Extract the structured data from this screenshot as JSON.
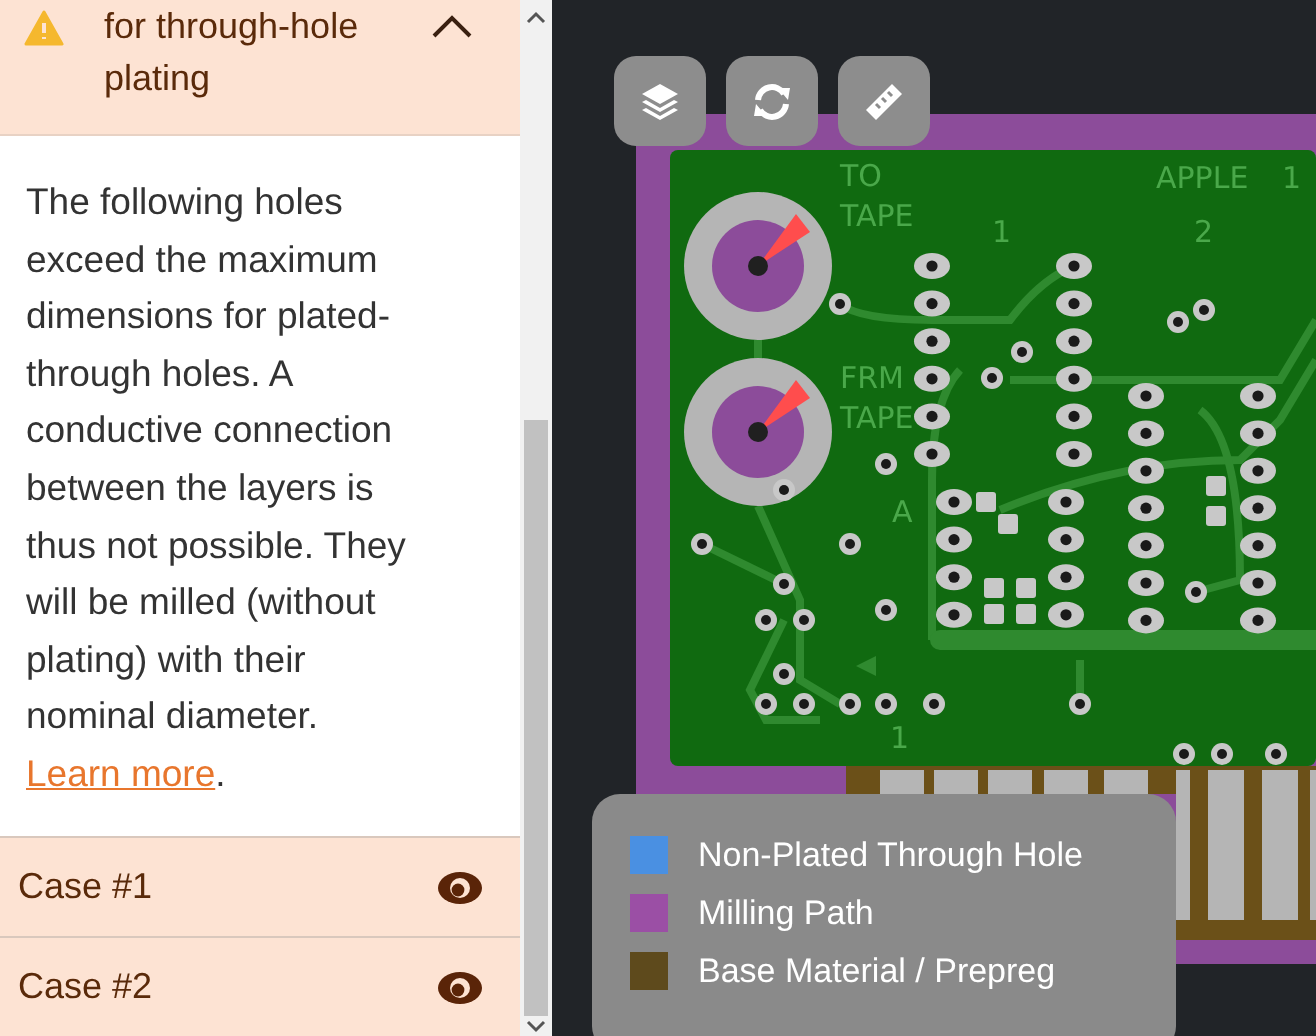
{
  "panel": {
    "header": {
      "title": "for through-hole plating",
      "expanded": true
    },
    "description": {
      "text": "The following holes exceed the maximum dimensions for plated-through holes. A conductive connection between the layers is thus not possible. They will be milled (without plating) with their nominal diameter.",
      "link": "Learn more",
      "after": "."
    },
    "cases": [
      {
        "label": "Case #1"
      },
      {
        "label": "Case #2"
      }
    ]
  },
  "board": {
    "silkscreen": [
      "TO",
      "TAPE",
      "APPLE",
      "1",
      "1",
      "2",
      "FRM",
      "TAPE",
      "A",
      "1"
    ]
  },
  "legend": [
    {
      "label": "Non-Plated Through Hole",
      "color": "#4a90e2"
    },
    {
      "label": "Milling Path",
      "color": "#9b4fa5"
    },
    {
      "label": "Base Material / Prepreg",
      "color": "#5e4a1c"
    }
  ]
}
